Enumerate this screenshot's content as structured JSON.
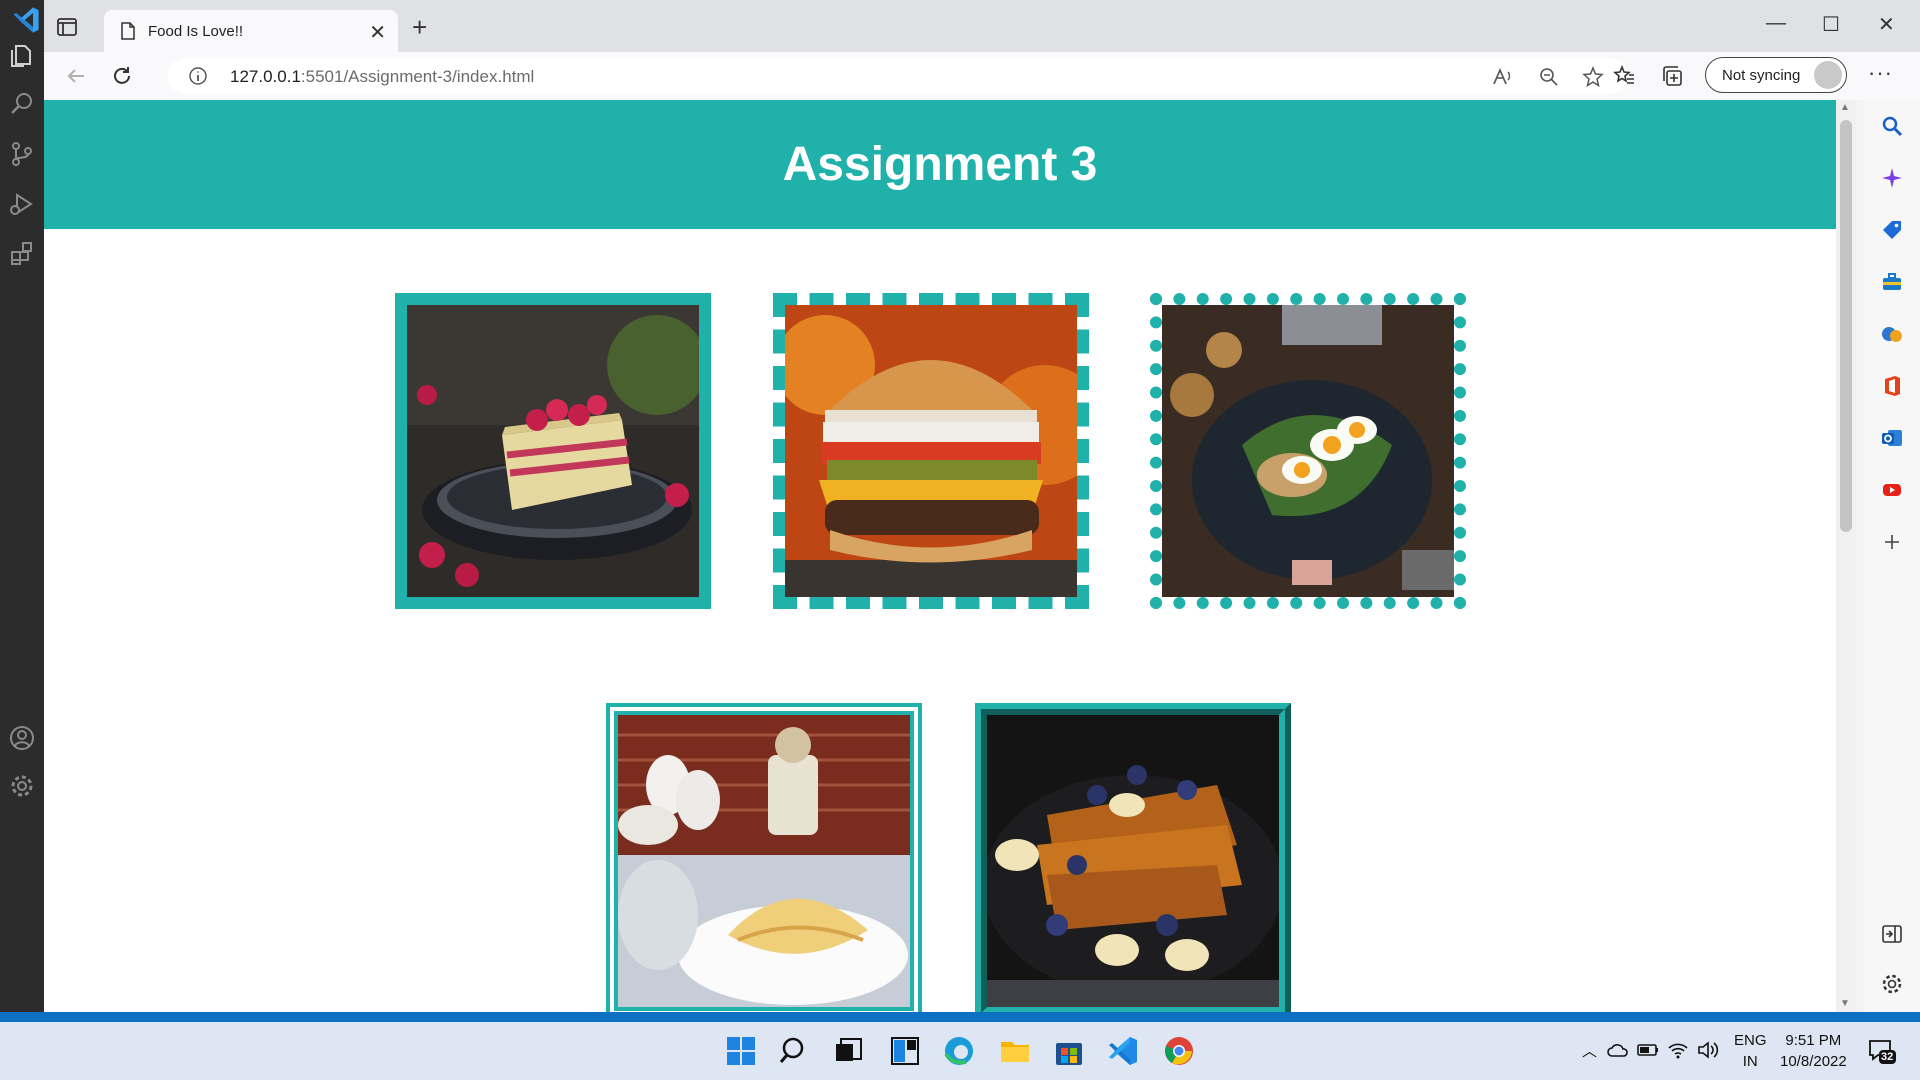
{
  "browser": {
    "tab_title": "Food Is Love!!",
    "url_host": "127.0.0.1",
    "url_rest": ":5501/Assignment-3/index.html",
    "sync_label": "Not syncing"
  },
  "page": {
    "heading": "Assignment 3",
    "accent_color": "#20b2aa",
    "images": [
      {
        "name": "raspberry-cake-photo",
        "border": "solid"
      },
      {
        "name": "burger-photo",
        "border": "dashed"
      },
      {
        "name": "egg-salad-photo",
        "border": "dotted"
      },
      {
        "name": "crepes-photo",
        "border": "double"
      },
      {
        "name": "french-toast-photo",
        "border": "ridge"
      }
    ]
  },
  "taskbar": {
    "lang_line1": "ENG",
    "lang_line2": "IN",
    "time": "9:51 PM",
    "date": "10/8/2022",
    "notif_count": "32"
  }
}
